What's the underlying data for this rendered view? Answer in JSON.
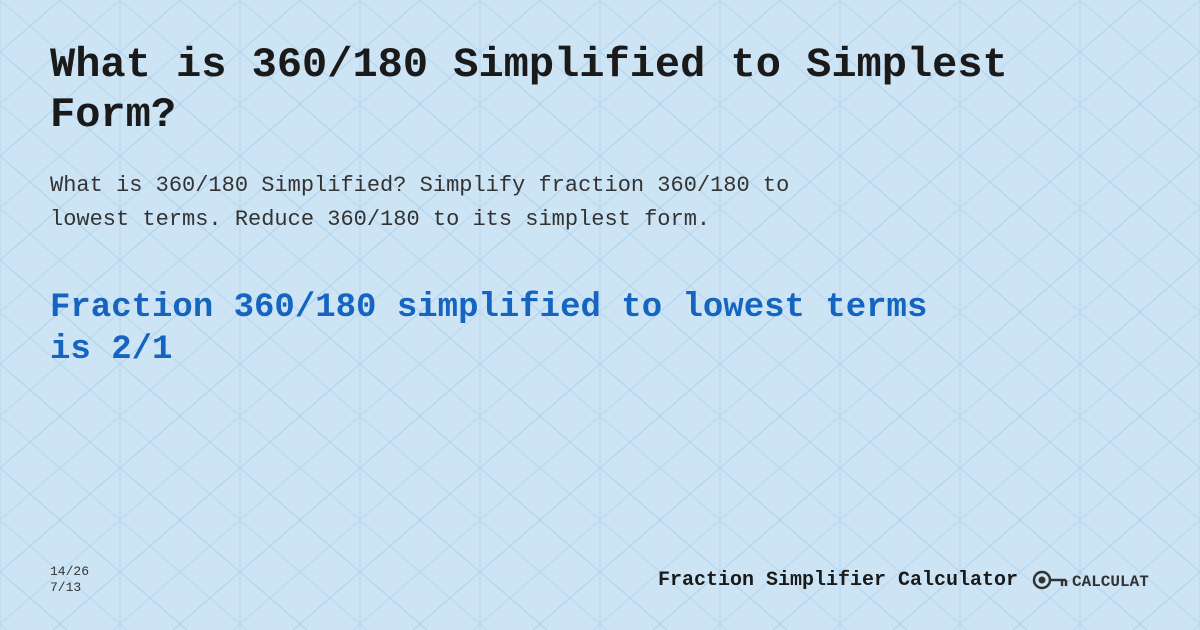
{
  "page": {
    "background_color": "#cde4f5"
  },
  "header": {
    "title": "What is 360/180 Simplified to Simplest Form?"
  },
  "description": {
    "text": "What is 360/180 Simplified? Simplify fraction 360/180 to lowest terms. Reduce 360/180 to its simplest form."
  },
  "result": {
    "text": "Fraction 360/180 simplified to lowest terms is 2/1"
  },
  "footer": {
    "fraction_top": "14/26",
    "fraction_bottom": "7/13",
    "brand_name": "Fraction Simplifier Calculator",
    "logo_alt": "calculat.io logo"
  }
}
